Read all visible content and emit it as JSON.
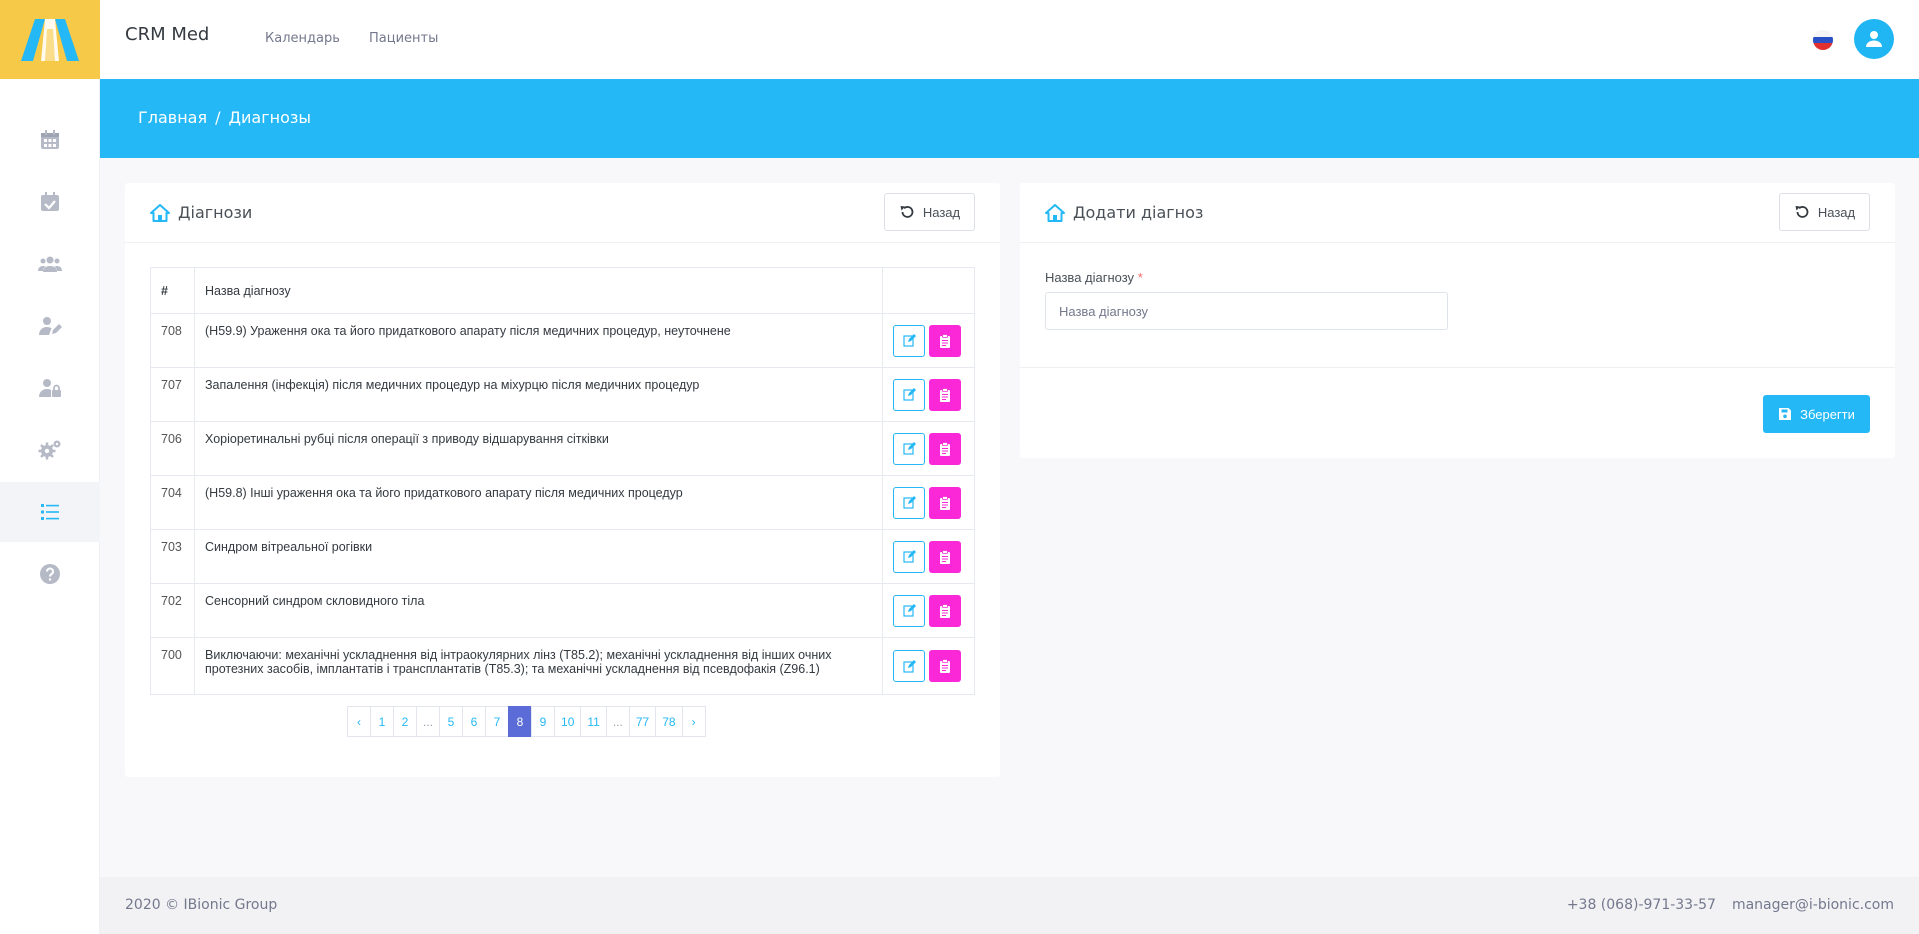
{
  "app": {
    "brand": "CRM Med"
  },
  "nav": {
    "calendar": "Календарь",
    "patients": "Пациенты"
  },
  "breadcrumb": {
    "home": "Главная",
    "separator": "/",
    "current": "Диагнозы"
  },
  "sidebar": {
    "icons": [
      "calendar-icon",
      "calendar-check-icon",
      "users-icon",
      "user-edit-icon",
      "user-lock-icon",
      "cogs-icon",
      "list-icon",
      "question-icon"
    ],
    "active": "list-icon"
  },
  "list_card": {
    "title": "Діагнози",
    "back_label": "Назад",
    "columns": {
      "num": "#",
      "name": "Назва діагнозу"
    },
    "rows": [
      {
        "id": "708",
        "name": "(H59.9) Ураження ока та його придаткового апарату після медичних процедур, неуточнене"
      },
      {
        "id": "707",
        "name": "Запалення (інфекція) після медичних процедур на міхурцю після медичних процедур"
      },
      {
        "id": "706",
        "name": "Хоріоретинальні рубці після операції з приводу відшарування сітківки"
      },
      {
        "id": "704",
        "name": "(H59.8) Інші ураження ока та його придаткового апарату після медичних процедур"
      },
      {
        "id": "703",
        "name": "Синдром вітреальної рогівки"
      },
      {
        "id": "702",
        "name": "Сенсорний синдром скловидного тіла"
      },
      {
        "id": "700",
        "name": "Виключаючи: механічні ускладнення від інтраокулярних лінз (T85.2); механічні ускладнення від інших очних протезних засобів, імплантатів і трансплантатів (T85.3); та механічні ускладнення від псевдофакія (Z96.1)"
      }
    ],
    "pagination": [
      "‹",
      "1",
      "2",
      "...",
      "5",
      "6",
      "7",
      "8",
      "9",
      "10",
      "11",
      "...",
      "77",
      "78",
      "›"
    ],
    "current_page": "8"
  },
  "form_card": {
    "title": "Додати діагноз",
    "back_label": "Назад",
    "field_label": "Назва діагнозу",
    "required_mark": "*",
    "field_placeholder": "Назва діагнозу",
    "field_value": "",
    "save_label": "Зберегти"
  },
  "footer": {
    "copyright": "2020 © IBionic Group",
    "phone": "+38 (068)-971-33-57",
    "email": "manager@i-bionic.com"
  },
  "colors": {
    "accent": "#24b8f6",
    "delete": "#fb28d8",
    "logo_bg": "#f7c948",
    "page_active": "#5b6bd8"
  }
}
